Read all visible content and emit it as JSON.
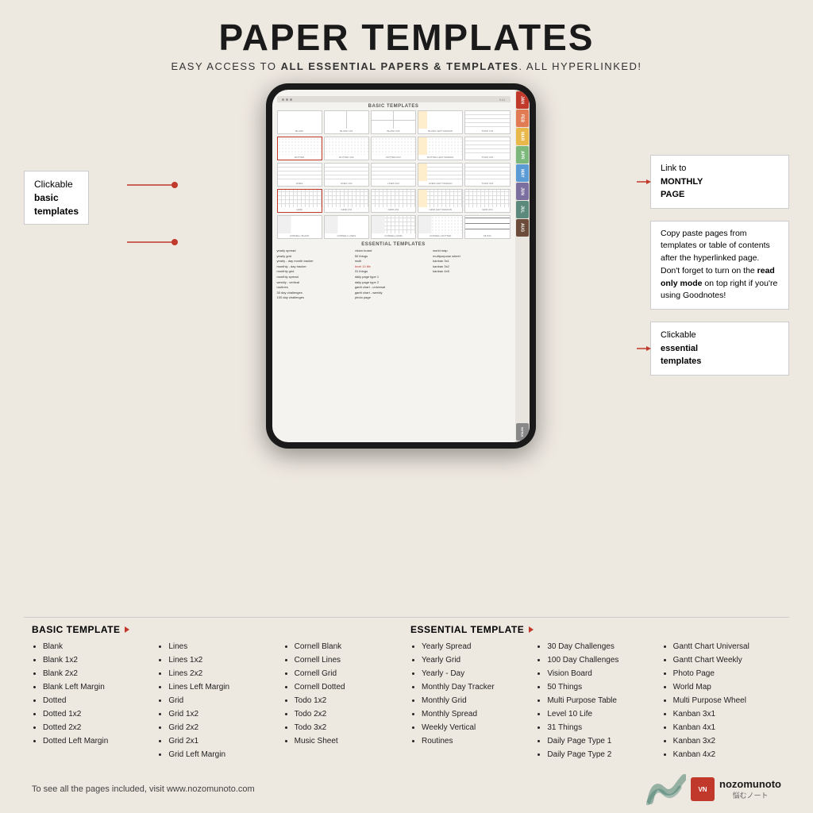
{
  "header": {
    "title": "PAPER TEMPLATES",
    "subtitle_plain": "EASY ACCESS TO ",
    "subtitle_bold": "ALL ESSENTIAL PAPERS & TEMPLATES",
    "subtitle_end": ". ALL HYPERLINKED!"
  },
  "annotations": {
    "left": {
      "label": "Clickable",
      "bold": "basic\ntemplates"
    },
    "right1": {
      "text": "Link to",
      "bold": "MONTHLY\nPAGE"
    },
    "right2": {
      "text_parts": [
        "Copy paste pages from templates or table of contents after the hyperlinked page. Don't forget to turn on the ",
        "read only mode",
        " on top right if you're using Goodnotes!"
      ]
    },
    "right3": {
      "label": "Clickable",
      "bold": "essential\ntemplates"
    }
  },
  "basic_template": {
    "header": "BASIC TEMPLATE",
    "columns": [
      [
        "Blank",
        "Blank 1x2",
        "Blank 2x2",
        "Blank Left Margin",
        "Dotted",
        "Dotted 1x2",
        "Dotted 2x2",
        "Dotted Left Margin"
      ],
      [
        "Lines",
        "Lines 1x2",
        "Lines 2x2",
        "Lines Left Margin",
        "Grid",
        "Grid 1x2",
        "Grid 2x2",
        "Grid 2x1",
        "Grid Left Margin"
      ],
      [
        "Cornell Blank",
        "Cornell Lines",
        "Cornell Grid",
        "Cornell Dotted",
        "Todo 1x2",
        "Todo 2x2",
        "Todo 3x2",
        "Music Sheet"
      ]
    ]
  },
  "essential_template": {
    "header": "ESSENTIAL TEMPLATE",
    "columns": [
      [
        "Yearly Spread",
        "Yearly Grid",
        "Yearly - Day",
        "Monthly Day Tracker",
        "Monthly Grid",
        "Monthly Spread",
        "Weekly Vertical",
        "Routines"
      ],
      [
        "30 Day Challenges",
        "100 Day Challenges",
        "Vision Board",
        "50 Things",
        "Multi Purpose Table",
        "Level 10 Life",
        "31 Things",
        "Daily Page Type 1",
        "Daily Page Type 2"
      ],
      [
        "Gantt Chart Universal",
        "Gantt Chart Weekly",
        "Photo Page",
        "World Map",
        "Multi Purpose Wheel",
        "Kanban 3x1",
        "Kanban 4x1",
        "Kanban 3x2",
        "Kanban 4x2"
      ]
    ]
  },
  "footer": {
    "text": "To see all the pages included, visit www.nozomunoto.com",
    "logo_abbr": "VN",
    "logo_name": "nozomunoto",
    "logo_sub": "悩むノート"
  },
  "sidebar_colors": [
    "#c0392b",
    "#e07b54",
    "#e8b84b",
    "#7cb87c",
    "#5b9bd5",
    "#7b6fa0",
    "#5b8a7c",
    "#6b4c3b"
  ],
  "sidebar_labels": [
    "JAN",
    "FEB",
    "MAR",
    "APR",
    "MAY",
    "JUN",
    "JUL",
    "AUG"
  ]
}
